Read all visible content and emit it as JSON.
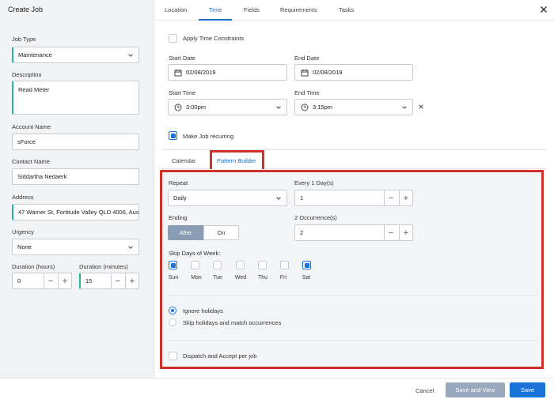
{
  "dialog": {
    "title": "Create Job"
  },
  "tabs": [
    {
      "label": "Location"
    },
    {
      "label": "Time"
    },
    {
      "label": "Fields"
    },
    {
      "label": "Requirements"
    },
    {
      "label": "Tasks"
    }
  ],
  "left": {
    "job_type_label": "Job Type",
    "job_type_value": "Maintenance",
    "description_label": "Description",
    "description_value": "Read Meter",
    "account_name_label": "Account Name",
    "account_name_value": "sForce",
    "contact_name_label": "Contact Name",
    "contact_name_value": "Siddartha Nedaerk",
    "address_label": "Address",
    "address_value": "47 Warner St, Fortitude Valley QLD 4006, Aus",
    "urgency_label": "Urgency",
    "urgency_value": "None",
    "duration_hours_label": "Duration (hours)",
    "duration_hours_value": "0",
    "duration_minutes_label": "Duration (minutes)",
    "duration_minutes_value": "15"
  },
  "time": {
    "apply_constraints_label": "Apply Time Constraints",
    "start_date_label": "Start Date",
    "start_date_value": "02/08/2019",
    "end_date_label": "End Date",
    "end_date_value": "02/08/2019",
    "start_time_label": "Start Time",
    "start_time_value": "3:00pm",
    "end_time_label": "End Time",
    "end_time_value": "3:15pm",
    "recurring_label": "Make Job recurring"
  },
  "subtabs": [
    {
      "label": "Calendar"
    },
    {
      "label": "Pattern Builder"
    }
  ],
  "pattern": {
    "repeat_label": "Repeat",
    "repeat_value": "Daily",
    "every_label": "Every 1 Day(s)",
    "every_value": "1",
    "ending_label": "Ending",
    "ending_after": "After",
    "ending_on": "On",
    "occurrences_label": "2 Occurrence(s)",
    "occurrences_value": "2",
    "skip_days_label": "Skip Days of Week:",
    "days": [
      "Sun",
      "Mon",
      "Tue",
      "Wed",
      "Thu",
      "Fri",
      "Sat"
    ],
    "ignore_holidays_label": "Ignore holidays",
    "skip_holidays_label": "Skip holidays and match occurrences",
    "dispatch_label": "Dispatch and Accept per job"
  },
  "footer": {
    "cancel_label": "Cancel",
    "save_view_label": "Save and View",
    "save_label": "Save"
  },
  "colors": {
    "accent": "#1a73d8",
    "highlight_border": "#d0302a",
    "teal": "#26b5a0"
  }
}
